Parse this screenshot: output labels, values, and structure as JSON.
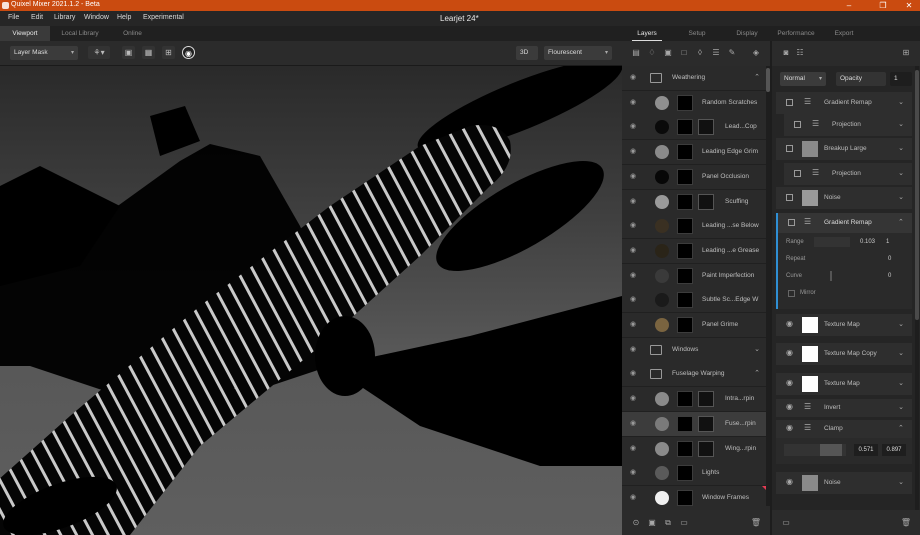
{
  "window": {
    "app_title": "Quixel Mixer 2021.1.2 - Beta",
    "document_title": "Learjet 24*",
    "controls": [
      "–",
      "❐",
      "✕"
    ]
  },
  "menu": [
    "File",
    "Edit",
    "Library",
    "Window",
    "Help",
    "Experimental"
  ],
  "viewport_tabs": [
    {
      "label": "Viewport",
      "active": true
    },
    {
      "label": "Local Library",
      "active": false
    },
    {
      "label": "Online",
      "active": false
    }
  ],
  "viewport_toolbar": {
    "mask_mode": "Layer Mask",
    "view_mode": "3D",
    "lighting": "Flourescent"
  },
  "right_tabs": [
    {
      "label": "Layers",
      "active": true
    },
    {
      "label": "Setup",
      "active": false
    },
    {
      "label": "Display",
      "active": false
    },
    {
      "label": "Performance",
      "active": false
    },
    {
      "label": "Export",
      "active": false
    }
  ],
  "layers": [
    {
      "type": "folder",
      "name": "Weathering",
      "expanded": true
    },
    {
      "type": "layer",
      "name": "Random Scratches",
      "dot": "#8f8f8f",
      "second_mask": false
    },
    {
      "type": "layer",
      "name": "Lead...Cop",
      "dot": "#0a0a0a",
      "second_mask": true
    },
    {
      "type": "layer",
      "name": "Leading Edge Grim",
      "dot": "#8a8a8a",
      "second_mask": false
    },
    {
      "type": "layer",
      "name": "Panel Occlusion",
      "dot": "#070707",
      "second_mask": false
    },
    {
      "type": "layer",
      "name": "Scuffing",
      "dot": "#9a9a9a",
      "second_mask": true
    },
    {
      "type": "layer",
      "name": "Leading ...se Below",
      "dot": "#3a3022",
      "second_mask": false
    },
    {
      "type": "layer",
      "name": "Leading ...e Grease",
      "dot": "#2a2418",
      "second_mask": false
    },
    {
      "type": "layer",
      "name": "Paint Imperfection",
      "dot": "#3a3a3a",
      "second_mask": false
    },
    {
      "type": "layer",
      "name": "Subtle Sc...Edge W",
      "dot": "#1a1a1a",
      "second_mask": false
    },
    {
      "type": "layer",
      "name": "Panel Grime",
      "dot": "#7a6440",
      "second_mask": false
    },
    {
      "type": "folder",
      "name": "Windows",
      "expanded": false
    },
    {
      "type": "folder",
      "name": "Fuselage Warping",
      "expanded": true
    },
    {
      "type": "layer",
      "name": "Intra...rpin",
      "dot": "#8a8a8a",
      "second_mask": true
    },
    {
      "type": "layer",
      "name": "Fuse...rpin",
      "dot": "#7a7a7a",
      "second_mask": true,
      "selected": true
    },
    {
      "type": "layer",
      "name": "Wing...rpin",
      "dot": "#8a8a8a",
      "second_mask": true
    },
    {
      "type": "layer",
      "name": "Lights",
      "dot": "#5a5a5a",
      "second_mask": false
    },
    {
      "type": "layer",
      "name": "Window Frames",
      "dot": "#f0f0f0",
      "second_mask": false
    }
  ],
  "props": {
    "blend_mode": "Normal",
    "opacity_label": "Opacity",
    "opacity_value": "1",
    "items": [
      "Gradient Remap",
      "Projection",
      "Breakup Large",
      "Projection",
      "Noise",
      "Gradient Remap"
    ],
    "gradient_remap": {
      "range_label": "Range",
      "range_low": "0.103",
      "range_high": "1",
      "repeat_label": "Repeat",
      "repeat_value": "0",
      "curve_label": "Curve",
      "curve_value": "0",
      "mirror_label": "Mirror"
    },
    "items2": [
      "Texture Map",
      "Texture Map Copy",
      "Texture Map",
      "Invert",
      "Clamp"
    ],
    "clamp": {
      "low": "0.571",
      "high": "0.897"
    },
    "last": "Noise"
  },
  "colors": {
    "titlebar": "#ca4b10",
    "accent_blue": "#2f8fd4",
    "marker_red": "#e33b53"
  }
}
